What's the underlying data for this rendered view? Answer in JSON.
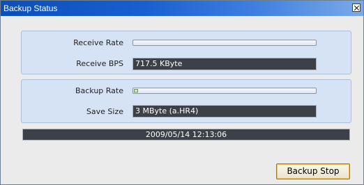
{
  "window": {
    "title": "Backup Status",
    "close_icon": "close-icon"
  },
  "receive": {
    "rate_label": "Receive Rate",
    "rate_progress": 0.0,
    "bps_label": "Receive BPS",
    "bps_value": "717.5 KByte"
  },
  "backup": {
    "rate_label": "Backup Rate",
    "rate_progress": 0.02,
    "size_label": "Save Size",
    "size_value": "3 MByte (a.HR4)"
  },
  "status": {
    "timestamp": "2009/05/14 12:13:06"
  },
  "buttons": {
    "stop_label": "Backup Stop"
  }
}
